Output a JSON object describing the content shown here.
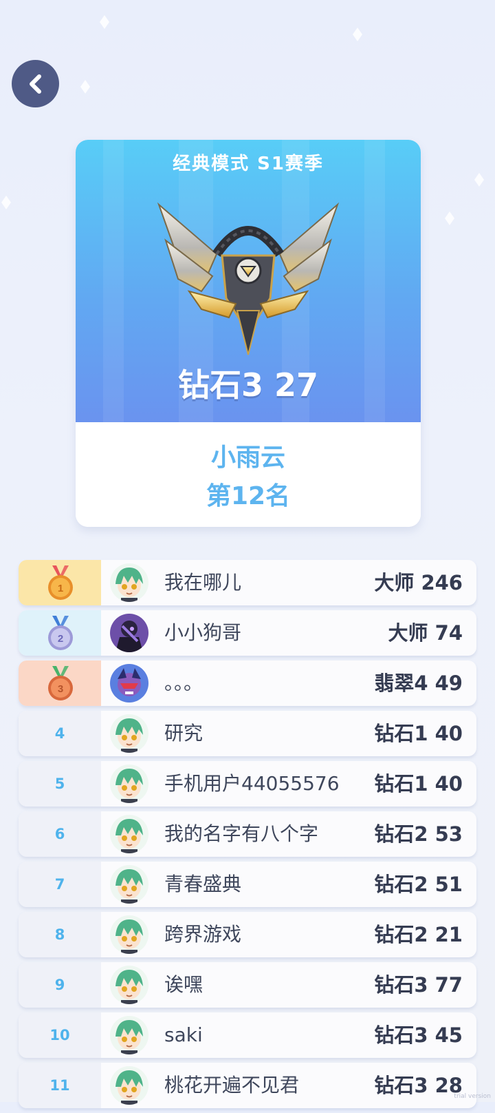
{
  "header": {
    "back_icon": "chevron-left-icon"
  },
  "card": {
    "season_title": "经典模式 S1赛季",
    "emblem_icon": "diamond-rank-emblem-icon",
    "rank_display": "钻石3 27",
    "player_name": "小雨云",
    "player_position": "第12名"
  },
  "leaderboard": [
    {
      "rank": "1",
      "medal": "gold",
      "name": "我在哪儿",
      "score": "大师 246",
      "avatar": "green-hair-avatar"
    },
    {
      "rank": "2",
      "medal": "silver",
      "name": "小小狗哥",
      "score": "大师 74",
      "avatar": "dark-armor-avatar"
    },
    {
      "rank": "3",
      "medal": "bronze",
      "name": "。。。",
      "score": "翡翠4 49",
      "avatar": "red-demon-avatar"
    },
    {
      "rank": "4",
      "name": "研究",
      "score": "钻石1 40",
      "avatar": "green-hair-avatar"
    },
    {
      "rank": "5",
      "name": "手机用户44055576",
      "score": "钻石1 40",
      "avatar": "green-hair-avatar"
    },
    {
      "rank": "6",
      "name": "我的名字有八个字",
      "score": "钻石2 53",
      "avatar": "green-hair-avatar"
    },
    {
      "rank": "7",
      "name": "青春盛典",
      "score": "钻石2 51",
      "avatar": "green-hair-avatar"
    },
    {
      "rank": "8",
      "name": "跨界游戏",
      "score": "钻石2 21",
      "avatar": "green-hair-avatar"
    },
    {
      "rank": "9",
      "name": "诶嘿",
      "score": "钻石3 77",
      "avatar": "green-hair-avatar"
    },
    {
      "rank": "10",
      "name": "saki",
      "score": "钻石3 45",
      "avatar": "green-hair-avatar"
    },
    {
      "rank": "11",
      "name": "桃花开遍不见君",
      "score": "钻石3 28",
      "avatar": "green-hair-avatar"
    }
  ],
  "watermark": "trial version",
  "colors": {
    "accent": "#5db4ef",
    "back_button": "#4f5a86",
    "gold": "#fbe6a8",
    "silver": "#dff2fa",
    "bronze": "#fbd7c6"
  }
}
